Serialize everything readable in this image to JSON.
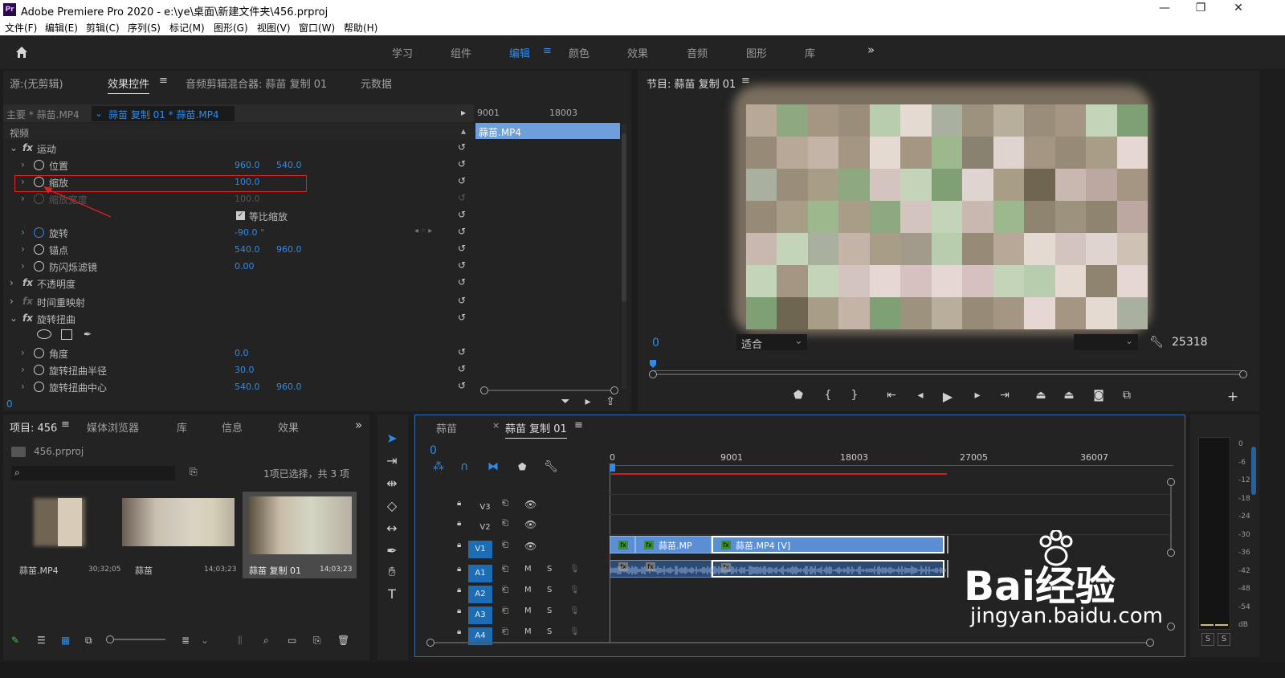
{
  "title_bar": {
    "app_icon": "Pr",
    "title": "Adobe Premiere Pro 2020 - e:\\ye\\桌面\\新建文件夹\\456.prproj",
    "minimize": "—",
    "restore": "❐",
    "close": "✕"
  },
  "menu": [
    "文件(F)",
    "编辑(E)",
    "剪辑(C)",
    "序列(S)",
    "标记(M)",
    "图形(G)",
    "视图(V)",
    "窗口(W)",
    "帮助(H)"
  ],
  "workspaces": {
    "items": [
      "学习",
      "组件",
      "编辑",
      "颜色",
      "效果",
      "音频",
      "图形",
      "库"
    ],
    "active": "编辑",
    "more": "»"
  },
  "effect_controls": {
    "tabs": [
      "源:(无剪辑)",
      "效果控件",
      "音频剪辑混合器: 蒜苗 复制 01",
      "元数据"
    ],
    "active_tab": "效果控件",
    "master_label": "主要 * 蒜苗.MP4",
    "sequence_label": "蒜苗 复制 01 * 蒜苗.MP4",
    "mini_ruler": [
      "9001",
      "18003"
    ],
    "mini_clip": "蒜苗.MP4",
    "section": "视频",
    "rows": [
      {
        "label": "运动",
        "kind": "fx"
      },
      {
        "label": "位置",
        "v1": "960.0",
        "v2": "540.0"
      },
      {
        "label": "缩放",
        "v1": "100.0",
        "highlight": true
      },
      {
        "label": "缩放宽度",
        "v1": "100.0",
        "disabled": true
      },
      {
        "label": "等比缩放",
        "kind": "checkbox"
      },
      {
        "label": "旋转",
        "v1": "-90.0 °"
      },
      {
        "label": "锚点",
        "v1": "540.0",
        "v2": "960.0"
      },
      {
        "label": "防闪烁滤镜",
        "v1": "0.00"
      },
      {
        "label": "不透明度",
        "kind": "fx"
      },
      {
        "label": "时间重映射",
        "kind": "fx"
      },
      {
        "label": "旋转扭曲",
        "kind": "fx"
      },
      {
        "label": "",
        "kind": "shapes"
      },
      {
        "label": "角度",
        "v1": "0.0"
      },
      {
        "label": "旋转扭曲半径",
        "v1": "30.0"
      },
      {
        "label": "旋转扭曲中心",
        "v1": "540.0",
        "v2": "960.0"
      }
    ],
    "footer_time": "0"
  },
  "program_monitor": {
    "title": "节目: 蒜苗 复制 01",
    "timecode": "0",
    "fit": "适合",
    "duration": "25318"
  },
  "project": {
    "tabs": [
      "项目: 456",
      "媒体浏览器",
      "库",
      "信息",
      "效果"
    ],
    "active_tab": "项目: 456",
    "file": "456.prproj",
    "search_placeholder": "",
    "selection_info": "1项已选择，共 3 项",
    "items": [
      {
        "name": "蒜苗.MP4",
        "duration": "30;32;05"
      },
      {
        "name": "蒜苗",
        "duration": "14;03;23"
      },
      {
        "name": "蒜苗 复制 01",
        "duration": "14;03;23"
      }
    ]
  },
  "timeline": {
    "tabs": [
      "蒜苗",
      "蒜苗 复制 01"
    ],
    "active_tab": "蒜苗 复制 01",
    "timecode": "0",
    "ruler": [
      "0",
      "9001",
      "18003",
      "27005",
      "36007"
    ],
    "tracks": [
      "V3",
      "V2",
      "V1",
      "A1",
      "A2",
      "A3",
      "A4"
    ],
    "clips": {
      "v1a": "蒜苗.MP",
      "v1b": "蒜苗.MP4 [V]"
    },
    "m": "M",
    "s": "S"
  },
  "meter": {
    "scale": [
      "0",
      "-6",
      "-12",
      "-18",
      "-24",
      "-30",
      "-36",
      "-42",
      "-48",
      "-54",
      "dB"
    ],
    "solo": [
      "S",
      "S"
    ]
  },
  "watermark": {
    "brand": "Bai经验",
    "url": "jingyan.baidu.com"
  },
  "colors": {
    "accent": "#2d8ceb",
    "panel": "#232323",
    "highlight_box": "#e02020"
  }
}
